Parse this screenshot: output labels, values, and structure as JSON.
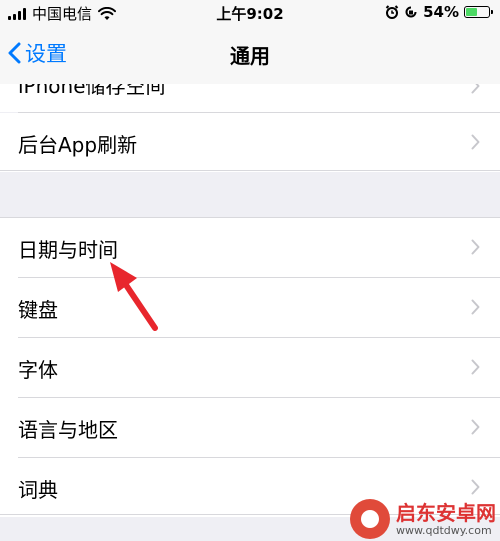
{
  "status": {
    "carrier": "中国电信",
    "time": "上午9:02",
    "battery_percent": "54%",
    "battery_level": 0.54,
    "icons": [
      "signal-icon",
      "wifi-icon",
      "alarm-icon",
      "orientation-lock-icon",
      "battery-icon"
    ]
  },
  "navbar": {
    "back_label": "设置",
    "title": "通用"
  },
  "top_group": {
    "partial_item": "iPhone储存空间",
    "items": [
      {
        "label": "后台App刷新"
      }
    ]
  },
  "main_group": {
    "items": [
      {
        "label": "日期与时间"
      },
      {
        "label": "键盘"
      },
      {
        "label": "字体"
      },
      {
        "label": "语言与地区"
      },
      {
        "label": "词典"
      }
    ]
  },
  "annotation": {
    "arrow_color": "#e8262d",
    "target": "日期与时间"
  },
  "watermark": {
    "name": "启东安卓网",
    "url": "www.qdtdwy.com"
  },
  "colors": {
    "accent": "#007aff",
    "background": "#efeff4",
    "chevron": "#c7c7cc",
    "battery_fill": "#4cd964"
  }
}
